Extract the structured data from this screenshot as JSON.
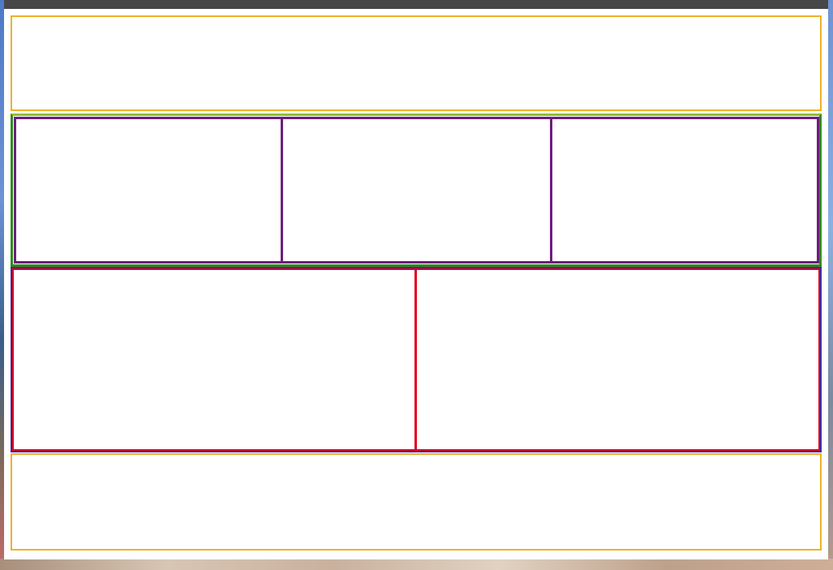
{
  "window": {
    "title": ""
  },
  "layout_panels": {
    "header": {
      "label": ""
    },
    "three_column_row": {
      "cells": [
        {
          "label": ""
        },
        {
          "label": ""
        },
        {
          "label": ""
        }
      ]
    },
    "two_column_row": {
      "cells": [
        {
          "label": ""
        },
        {
          "label": ""
        }
      ]
    },
    "footer": {
      "label": ""
    }
  },
  "colors": {
    "titlebar": "#474747",
    "header_footer_border": "#f0b12a",
    "three_column_row_border": "#2e8b1c",
    "three_column_cell_border": "#6f1d7e",
    "two_column_row_border": "#3a2aa0",
    "two_column_cell_border": "#e0001b"
  }
}
